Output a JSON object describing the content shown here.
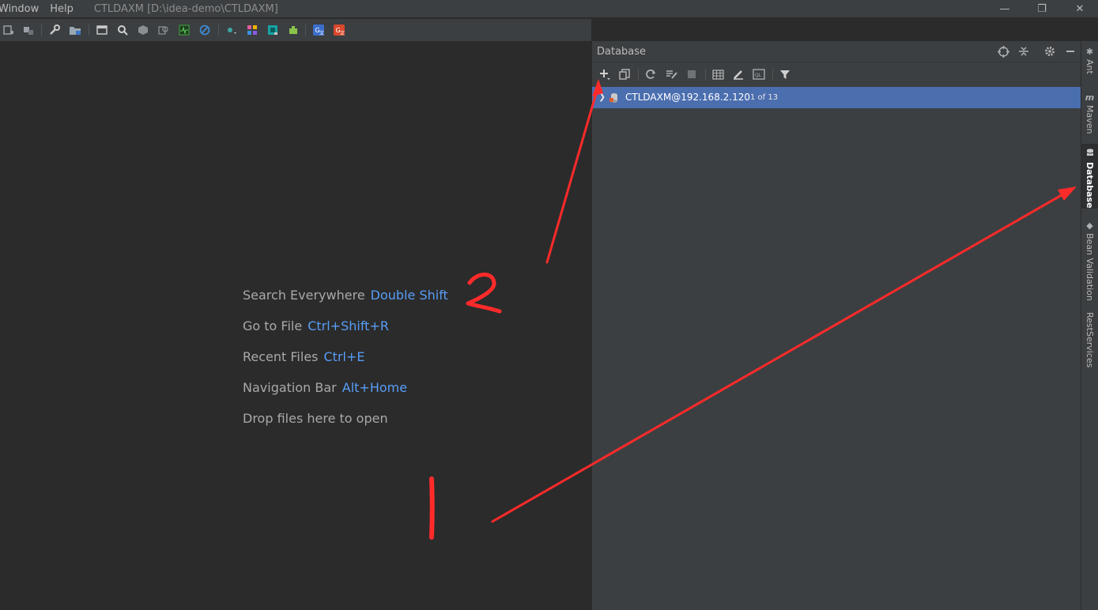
{
  "titlebar": {
    "menu": [
      "Window",
      "Help"
    ],
    "title": "CTLDAXM [D:\\idea-demo\\CTLDAXM]",
    "minimize": "—",
    "restore": "❐",
    "close": "✕"
  },
  "toolbar": {
    "icons": [
      "project-structure-icon",
      "build-icon",
      "wrench-icon",
      "folder-icon",
      "terminal-icon",
      "search-icon",
      "hexagon-icon",
      "find-usages-icon",
      "monitor-icon",
      "no-entry-icon",
      "navigate-icon",
      "plugin-grid-icon",
      "qr-icon",
      "puzzle-icon",
      "translate-icon",
      "translate-alt-icon"
    ]
  },
  "editor": {
    "hints": [
      {
        "action": "Search Everywhere",
        "shortcut": "Double Shift"
      },
      {
        "action": "Go to File",
        "shortcut": "Ctrl+Shift+R"
      },
      {
        "action": "Recent Files",
        "shortcut": "Ctrl+E"
      },
      {
        "action": "Navigation Bar",
        "shortcut": "Alt+Home"
      },
      {
        "action": "Drop files here to open",
        "shortcut": ""
      }
    ]
  },
  "database_panel": {
    "title": "Database",
    "tree": [
      {
        "name": "CTLDAXM@192.168.2.120",
        "count": "1 of 13"
      }
    ]
  },
  "side_strip": {
    "tabs": [
      {
        "label": "Ant",
        "icon": "ant-icon"
      },
      {
        "label": "Maven",
        "icon": "maven-icon"
      },
      {
        "label": "Database",
        "icon": "database-icon",
        "active": true
      },
      {
        "label": "Bean Validation",
        "icon": "bean-validation-icon"
      },
      {
        "label": "RestServices",
        "icon": ""
      }
    ]
  },
  "annotations": {
    "step_1": "1",
    "step_2": "2",
    "color": "#ff2a2a"
  },
  "colors": {
    "editor_bg": "#2b2b2b",
    "panel_bg": "#3c3f41",
    "selection": "#4b6eaf",
    "shortcut": "#589df6"
  }
}
